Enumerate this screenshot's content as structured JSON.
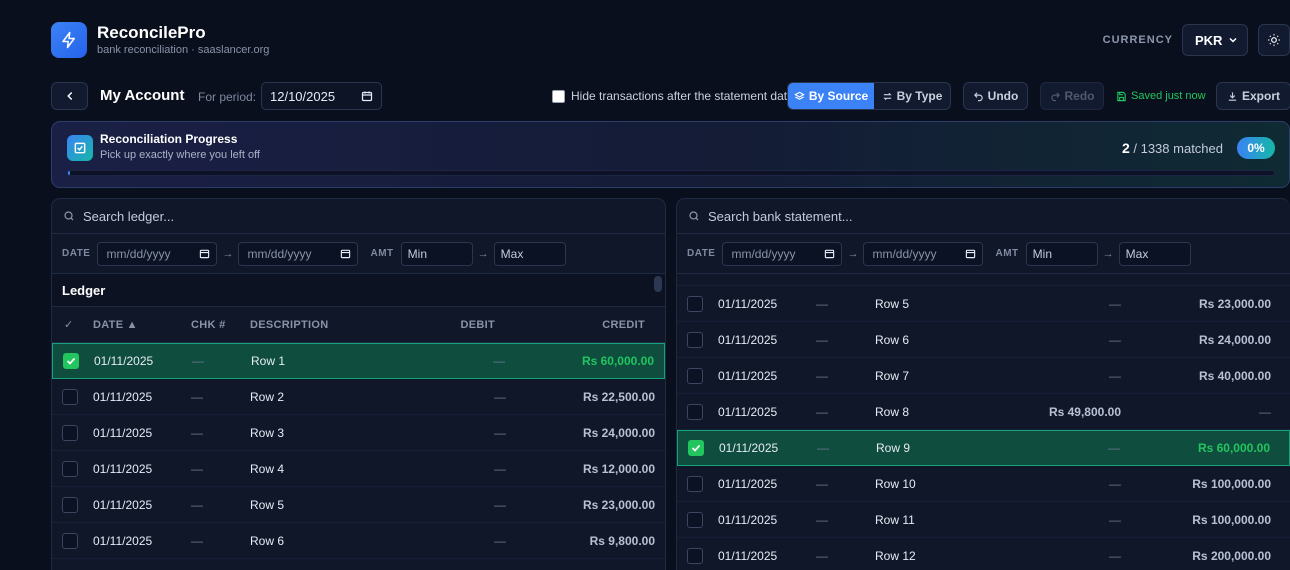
{
  "app": {
    "name": "ReconcilePro",
    "subtitle": "bank reconciliation · saaslancer.org"
  },
  "currency": {
    "label": "CURRENCY",
    "value": "PKR"
  },
  "icons": {
    "brand": "lightning-icon",
    "theme": "sun-icon",
    "back": "chevron-left-icon",
    "progress": "checkbox-icon"
  },
  "toolbar": {
    "account_title": "My Account",
    "period_label": "For period:",
    "period_value": "12/10/2025",
    "hide_label": "Hide transactions after the statement date",
    "by_source": "By Source",
    "by_type": "By Type",
    "undo": "Undo",
    "redo": "Redo",
    "saved": "Saved just now",
    "export": "Export"
  },
  "progress": {
    "title": "Reconciliation Progress",
    "subtitle": "Pick up exactly where you left off",
    "matched": "2",
    "total_text": " / 1338 matched",
    "percent_label": "0%",
    "fraction": 0.0015
  },
  "filters": {
    "date_label": "DATE",
    "amt_label": "AMT",
    "date_placeholder": "mm/dd/yyyy",
    "min": "Min",
    "max": "Max",
    "arrow": "→"
  },
  "ledger": {
    "search_placeholder": "Search ledger...",
    "section": "Ledger",
    "columns": {
      "check": "✓",
      "date": "DATE ▲",
      "chk": "CHK #",
      "desc": "DESCRIPTION",
      "debit": "DEBIT",
      "credit": "CREDIT"
    },
    "rows": [
      {
        "date": "01/11/2025",
        "chk": "—",
        "desc": "Row 1",
        "debit": "—",
        "credit": "Rs 60,000.00",
        "matched": true
      },
      {
        "date": "01/11/2025",
        "chk": "—",
        "desc": "Row 2",
        "debit": "—",
        "credit": "Rs 22,500.00",
        "matched": false
      },
      {
        "date": "01/11/2025",
        "chk": "—",
        "desc": "Row 3",
        "debit": "—",
        "credit": "Rs 24,000.00",
        "matched": false
      },
      {
        "date": "01/11/2025",
        "chk": "—",
        "desc": "Row 4",
        "debit": "—",
        "credit": "Rs 12,000.00",
        "matched": false
      },
      {
        "date": "01/11/2025",
        "chk": "—",
        "desc": "Row 5",
        "debit": "—",
        "credit": "Rs 23,000.00",
        "matched": false
      },
      {
        "date": "01/11/2025",
        "chk": "—",
        "desc": "Row 6",
        "debit": "—",
        "credit": "Rs 9,800.00",
        "matched": false
      }
    ]
  },
  "bank": {
    "search_placeholder": "Search bank statement...",
    "rows": [
      {
        "date": "01/11/2025",
        "chk": "—",
        "desc": "Row 5",
        "debit": "—",
        "credit": "Rs 23,000.00",
        "matched": false
      },
      {
        "date": "01/11/2025",
        "chk": "—",
        "desc": "Row 6",
        "debit": "—",
        "credit": "Rs 24,000.00",
        "matched": false
      },
      {
        "date": "01/11/2025",
        "chk": "—",
        "desc": "Row 7",
        "debit": "—",
        "credit": "Rs 40,000.00",
        "matched": false
      },
      {
        "date": "01/11/2025",
        "chk": "—",
        "desc": "Row 8",
        "debit": "Rs 49,800.00",
        "credit": "—",
        "matched": false
      },
      {
        "date": "01/11/2025",
        "chk": "—",
        "desc": "Row 9",
        "debit": "—",
        "credit": "Rs 60,000.00",
        "matched": true
      },
      {
        "date": "01/11/2025",
        "chk": "—",
        "desc": "Row 10",
        "debit": "—",
        "credit": "Rs 100,000.00",
        "matched": false
      },
      {
        "date": "01/11/2025",
        "chk": "—",
        "desc": "Row 11",
        "debit": "—",
        "credit": "Rs 100,000.00",
        "matched": false
      },
      {
        "date": "01/11/2025",
        "chk": "—",
        "desc": "Row 12",
        "debit": "—",
        "credit": "Rs 200,000.00",
        "matched": false
      }
    ]
  },
  "colors": {
    "accent": "#3b82f6",
    "matched_bg": "#0f4d3f",
    "success": "#22c55e"
  }
}
